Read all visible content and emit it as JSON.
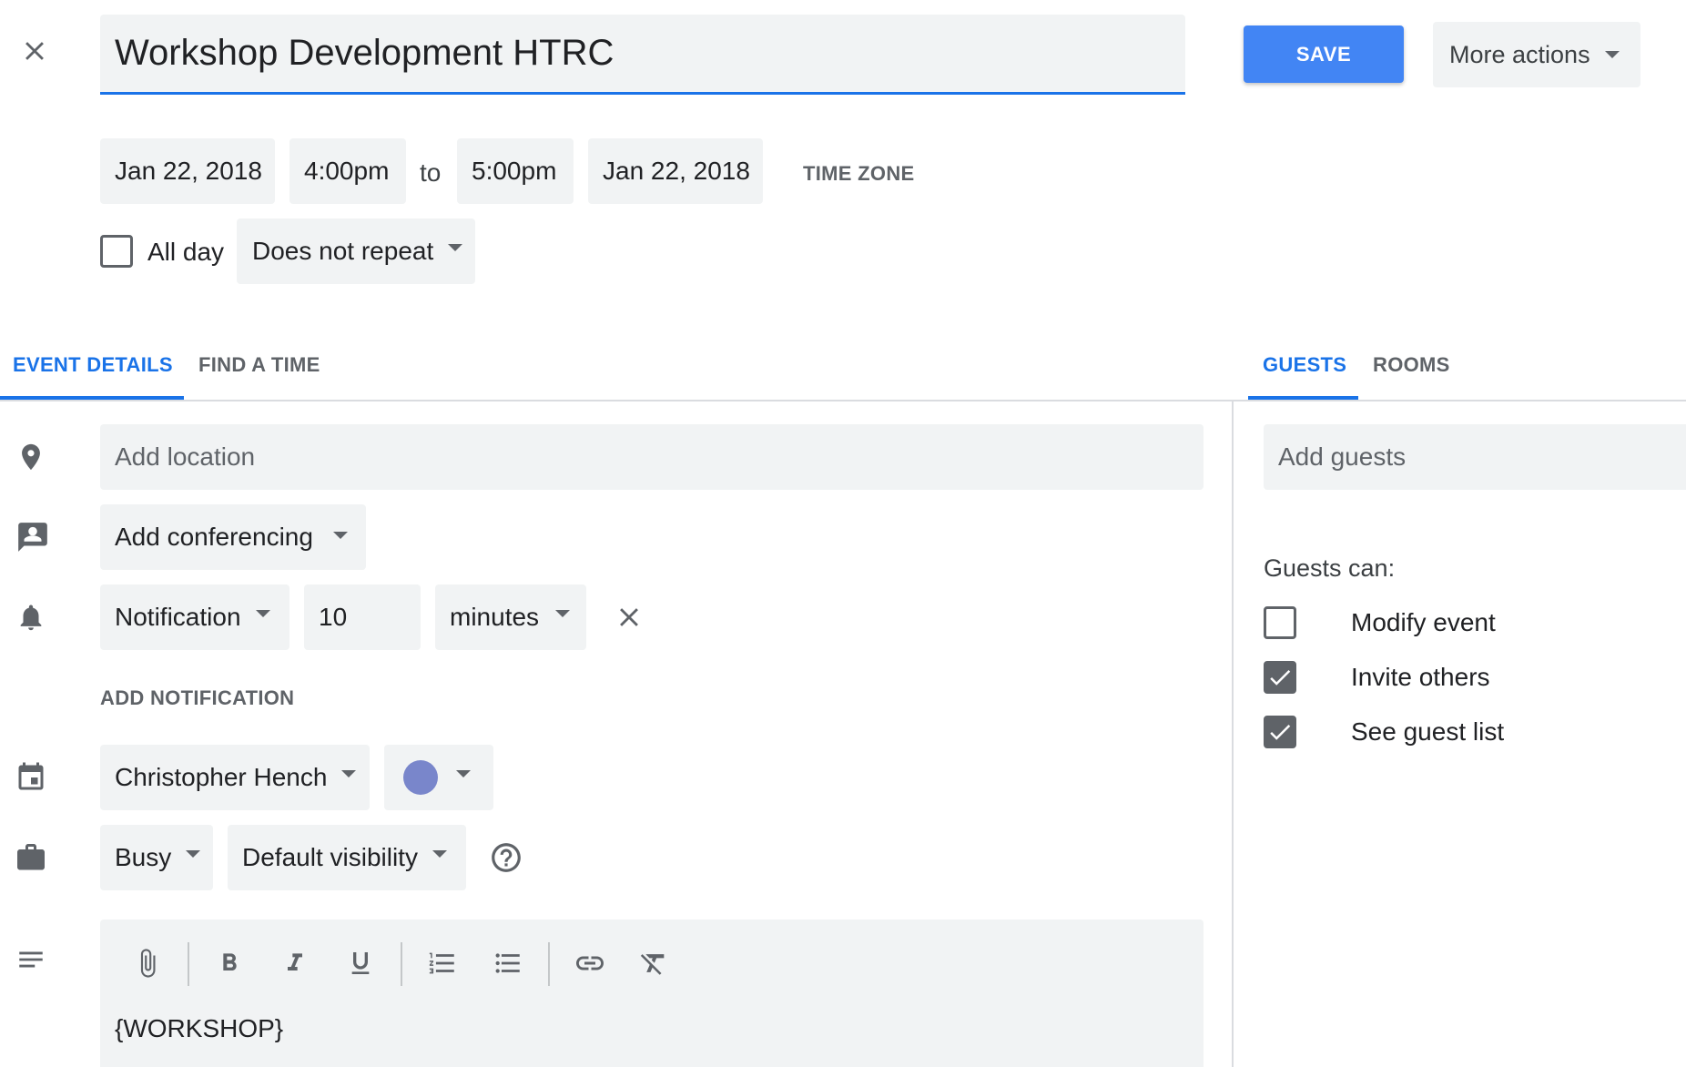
{
  "header": {
    "title": "Workshop Development HTRC",
    "save_label": "SAVE",
    "more_actions_label": "More actions"
  },
  "datetime": {
    "start_date": "Jan 22, 2018",
    "start_time": "4:00pm",
    "to_label": "to",
    "end_time": "5:00pm",
    "end_date": "Jan 22, 2018",
    "timezone_label": "TIME ZONE",
    "all_day_label": "All day",
    "all_day_checked": false,
    "repeat_value": "Does not repeat"
  },
  "tabs": {
    "left": [
      {
        "label": "EVENT DETAILS",
        "active": true
      },
      {
        "label": "FIND A TIME",
        "active": false
      }
    ],
    "right": [
      {
        "label": "GUESTS",
        "active": true
      },
      {
        "label": "ROOMS",
        "active": false
      }
    ]
  },
  "details": {
    "location_placeholder": "Add location",
    "conferencing_label": "Add conferencing",
    "notification": {
      "type": "Notification",
      "amount": "10",
      "unit": "minutes"
    },
    "add_notification_label": "ADD NOTIFICATION",
    "calendar_owner": "Christopher Hench",
    "event_color": "#7986cb",
    "availability": "Busy",
    "visibility": "Default visibility",
    "description": "{WORKSHOP}"
  },
  "guests": {
    "add_placeholder": "Add guests",
    "permissions_heading": "Guests can:",
    "permissions": [
      {
        "label": "Modify event",
        "checked": false
      },
      {
        "label": "Invite others",
        "checked": true
      },
      {
        "label": "See guest list",
        "checked": true
      }
    ]
  },
  "colors": {
    "accent": "#1a73e8",
    "save_button": "#4285f4",
    "field_bg": "#f1f3f4",
    "icon_gray": "#5f6368"
  }
}
